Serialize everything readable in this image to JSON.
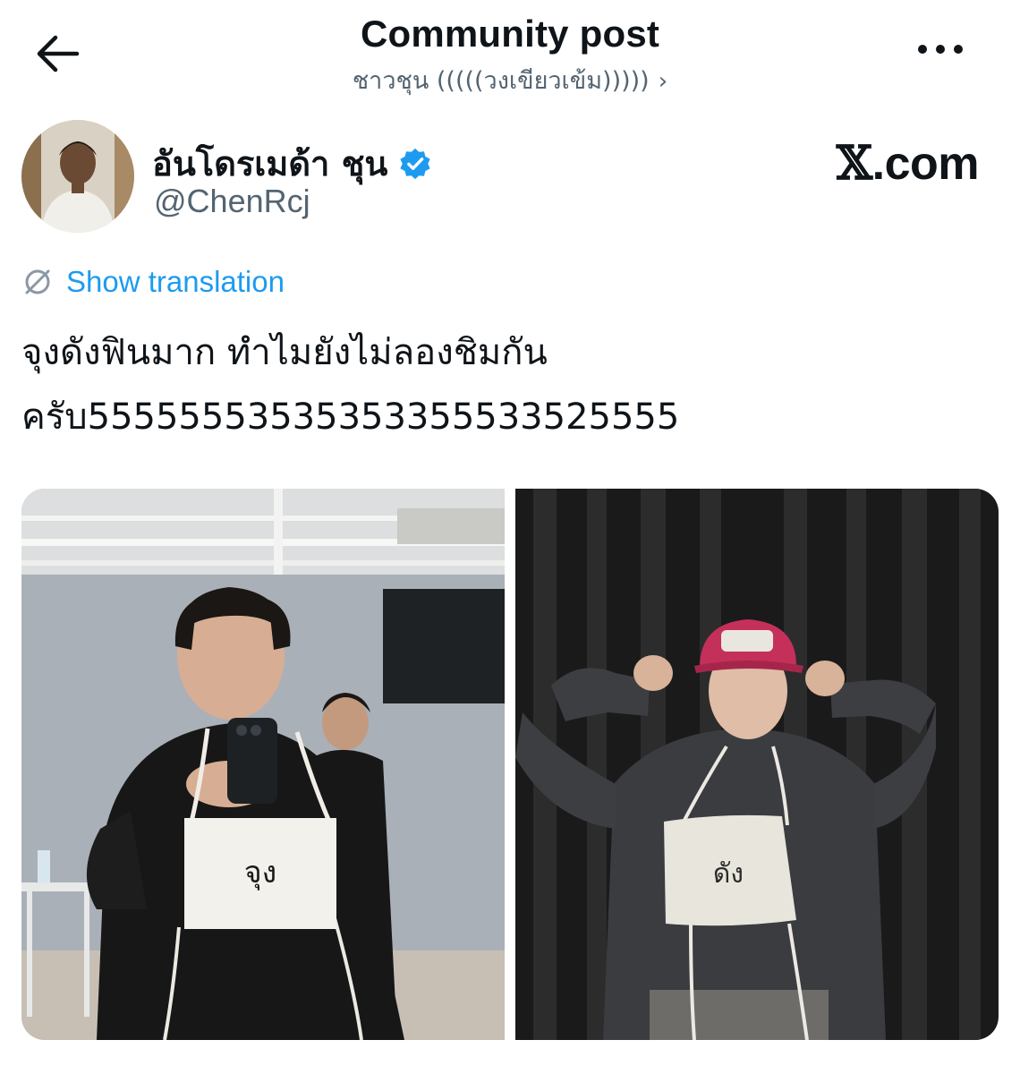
{
  "header": {
    "title": "Community post",
    "community_name": "ชาวชุน (((((วงเขียวเข้ม)))))",
    "chevron": "›"
  },
  "author": {
    "display_name": "อันโดรเมด้า ชุน",
    "handle": "@ChenRcj",
    "verified": true
  },
  "brand": {
    "x": "𝕏",
    "domain": ".com"
  },
  "translation": {
    "label": "Show translation"
  },
  "post": {
    "line1": "จุงดังฟินมาก ทำไมยังไม่ลองชิมกัน",
    "line2": "ครับ55555553535353355533525555"
  },
  "media": {
    "images": [
      {
        "apron_text": "จุง"
      },
      {
        "apron_text": "ดัง"
      }
    ]
  },
  "colors": {
    "accent": "#1d9bf0",
    "secondary_text": "#536471",
    "primary_text": "#0f1419",
    "cap": "#c5305b"
  },
  "icons": [
    "back-arrow-icon",
    "more-icon",
    "verified-badge-icon",
    "translate-globe-icon"
  ]
}
